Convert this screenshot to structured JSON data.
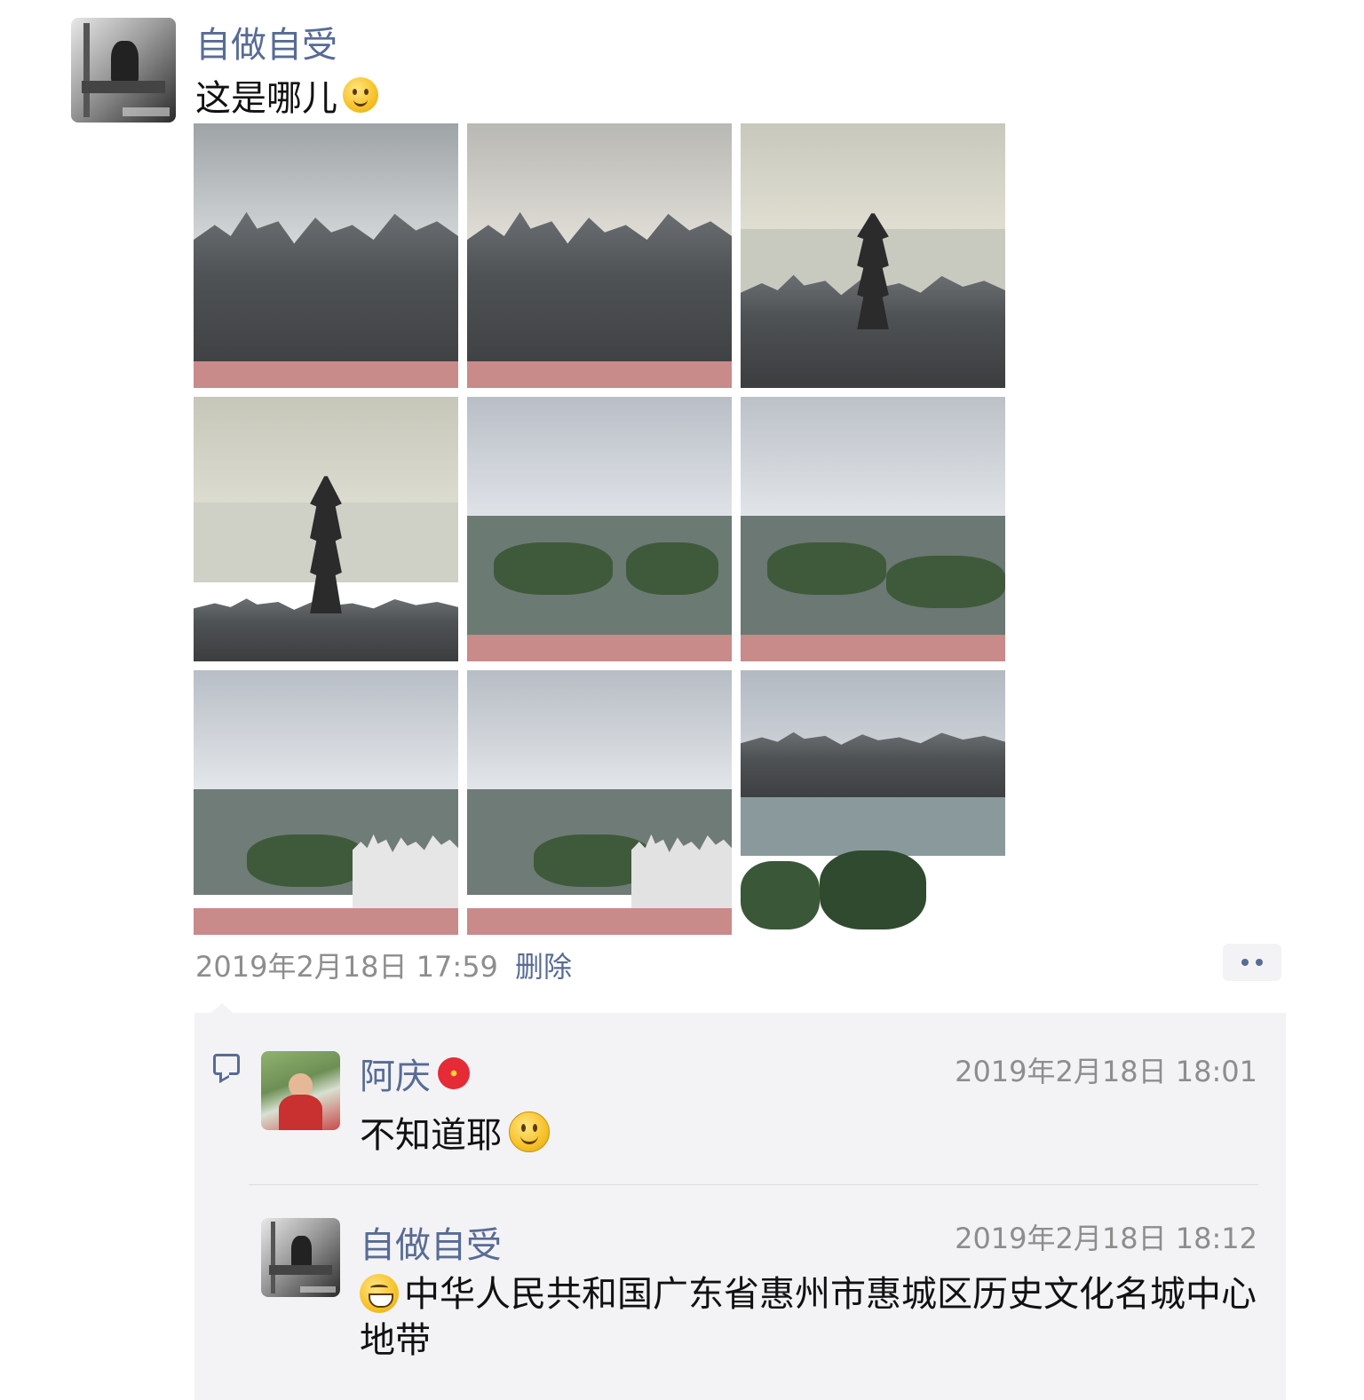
{
  "post": {
    "author": "自做自受",
    "text": "这是哪儿",
    "text_emoji": "thinking-face-icon",
    "photos": [
      {
        "name": "photo-1"
      },
      {
        "name": "photo-2"
      },
      {
        "name": "photo-3"
      },
      {
        "name": "photo-4"
      },
      {
        "name": "photo-5"
      },
      {
        "name": "photo-6"
      },
      {
        "name": "photo-7"
      },
      {
        "name": "photo-8"
      },
      {
        "name": "photo-9"
      }
    ],
    "timestamp": "2019年2月18日 17:59",
    "delete_label": "删除",
    "more_icon": "more-dots-icon"
  },
  "comments": [
    {
      "author": "阿庆",
      "author_emoji": "hibiscus-icon",
      "time": "2019年2月18日 18:01",
      "text": "不知道耶",
      "text_emoji": "smiling-face-icon"
    },
    {
      "author": "自做自受",
      "time": "2019年2月18日 18:12",
      "text_emoji": "grinning-face-icon",
      "text": "中华人民共和国广东省惠州市惠城区历史文化名城中心地带"
    }
  ],
  "colors": {
    "link": "#576b95",
    "meta": "#8d8d8d",
    "comment_bg": "#f3f3f5"
  }
}
